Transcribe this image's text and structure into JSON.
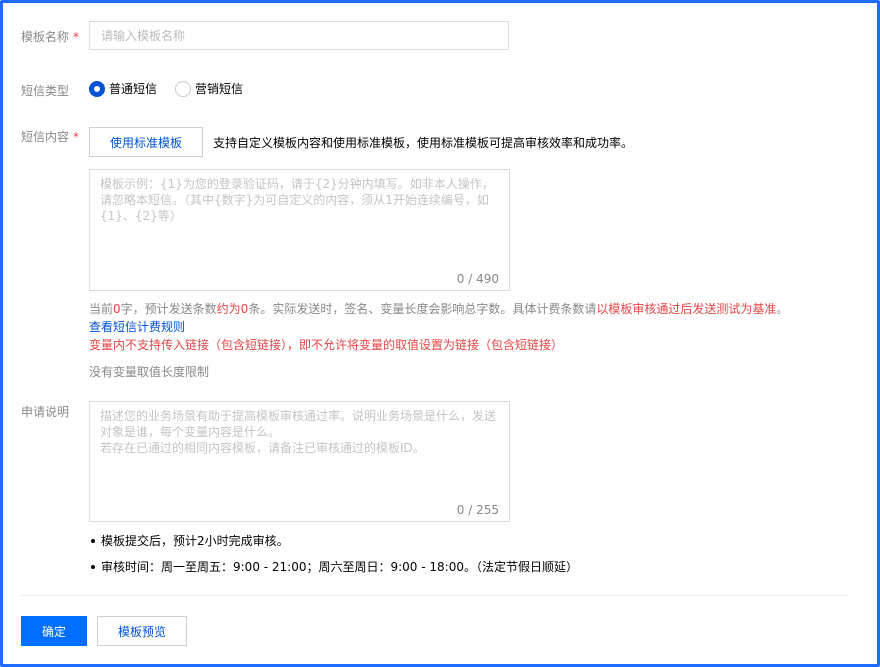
{
  "form": {
    "template_name": {
      "label": "模板名称",
      "required_mark": "*",
      "placeholder": "请输入模板名称"
    },
    "sms_type": {
      "label": "短信类型",
      "options": [
        {
          "label": "普通短信",
          "selected": true
        },
        {
          "label": "营销短信",
          "selected": false
        }
      ]
    },
    "sms_content": {
      "label": "短信内容",
      "required_mark": "*",
      "use_standard_button": "使用标准模板",
      "description": "支持自定义模板内容和使用标准模板，使用标准模板可提高审核效率和成功率。",
      "placeholder": "模板示例：{1}为您的登录验证码，请于{2}分钟内填写。如非本人操作，请忽略本短信。（其中{数字}为可自定义的内容，须从1开始连续编号，如{1}、{2}等）",
      "counter": "0 / 490",
      "stats": {
        "prefix": "当前",
        "char_count": "0",
        "middle1": "字，预计发送条数",
        "sms_count": "约为0",
        "middle2": "条。实际发送时，签名、变量长度会影响总字数。具体计费条数请",
        "suffix_red": "以模板审核通过后发送测试为基准",
        "end": "。"
      },
      "billing_rule_link": "查看短信计费规则",
      "variable_warning": "变量内不支持传入链接（包含短链接），即不允许将变量的取值设置为链接（包含短链接）",
      "no_limit_note": "没有变量取值长度限制"
    },
    "application_note": {
      "label": "申请说明",
      "placeholder": "描述您的业务场景有助于提高模板审核通过率。说明业务场景是什么，发送对象是谁，每个变量内容是什么。\n若存在已通过的相同内容模板，请备注已审核通过的模板ID。",
      "counter": "0 / 255"
    },
    "notes": [
      "模板提交后，预计2小时完成审核。",
      "审核时间：周一至周五：9:00 - 21:00；周六至周日：9:00 - 18:00。（法定节假日顺延）"
    ],
    "actions": {
      "confirm": "确定",
      "preview": "模板预览"
    }
  },
  "colors": {
    "primary": "#006eff",
    "link": "#0052d9",
    "required": "#e54545",
    "border_frame": "#1f6bff"
  }
}
